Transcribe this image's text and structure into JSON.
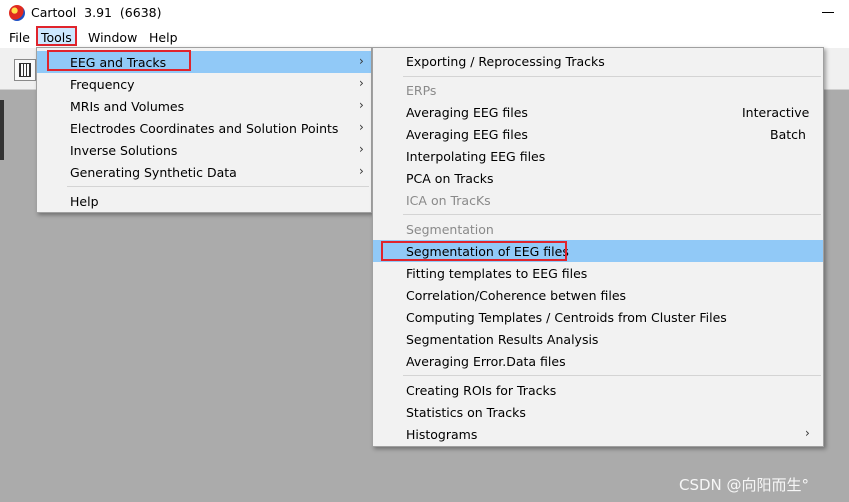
{
  "window": {
    "title": "Cartool  3.91  (6638)",
    "minimize_glyph": ""
  },
  "menubar": {
    "items": [
      "File",
      "Tools",
      "Window",
      "Help"
    ]
  },
  "tools_menu": {
    "items": [
      {
        "label": "EEG and Tracks",
        "submenu": true,
        "arrow": "›"
      },
      {
        "label": "Frequency",
        "submenu": true,
        "arrow": "›"
      },
      {
        "label": "MRIs and Volumes",
        "submenu": true,
        "arrow": "›"
      },
      {
        "label": "Electrodes Coordinates and Solution Points",
        "submenu": true,
        "arrow": "›"
      },
      {
        "label": "Inverse Solutions",
        "submenu": true,
        "arrow": "›"
      },
      {
        "label": "Generating Synthetic Data",
        "submenu": true,
        "arrow": "›"
      },
      {
        "label": "Help"
      }
    ]
  },
  "eeg_menu": {
    "exporting": "Exporting / Reprocessing Tracks",
    "erps_header": "ERPs",
    "averaging_interactive": {
      "label": "Averaging EEG files",
      "right": "Interactive"
    },
    "averaging_batch": {
      "label": "Averaging EEG files",
      "right": "Batch"
    },
    "interpolating": "Interpolating EEG files",
    "pca": "PCA on Tracks",
    "ica": "ICA on TracKs",
    "segmentation_header": "Segmentation",
    "segmentation": "Segmentation of EEG files",
    "fitting": "Fitting templates to EEG files",
    "correlation": "Correlation/Coherence betwen files",
    "computing": "Computing Templates / Centroids from Cluster Files",
    "seg_results": "Segmentation Results Analysis",
    "averaging_error": "Averaging Error.Data files",
    "creating_rois": "Creating ROIs for Tracks",
    "statistics": "Statistics on Tracks",
    "histograms": "Histograms",
    "histograms_arrow": "›"
  },
  "watermark": "CSDN @向阳而生°",
  "colors": {
    "highlight": "#91c9f7",
    "menubar_active": "#cce8ff",
    "annotation_red": "#e0242c",
    "workspace": "#ababab"
  }
}
